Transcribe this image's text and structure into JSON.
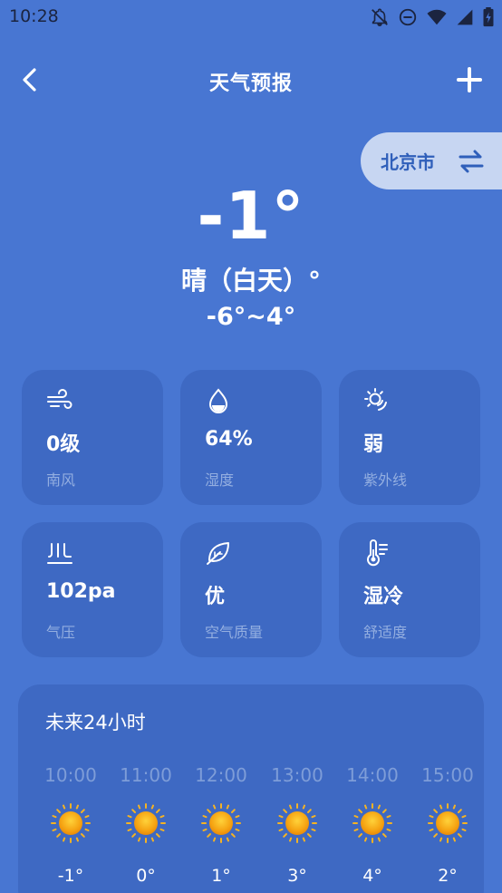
{
  "status_bar": {
    "time": "10:28",
    "icons": [
      "notifications-off-icon",
      "do-not-disturb-icon",
      "wifi-icon",
      "signal-icon",
      "battery-icon"
    ]
  },
  "app_bar": {
    "title": "天气预报",
    "back_icon": "chevron-left-icon",
    "add_icon": "plus-icon"
  },
  "location": {
    "city": "北京市",
    "switch_icon": "swap-arrows-icon"
  },
  "current": {
    "temperature": "-1°",
    "condition": "晴（白天）°",
    "range": "-6°~4°"
  },
  "tiles": [
    {
      "icon": "wind-icon",
      "value": "0级",
      "label": "南风"
    },
    {
      "icon": "humidity-icon",
      "value": "64%",
      "label": "湿度"
    },
    {
      "icon": "uv-sun-icon",
      "value": "弱",
      "label": "紫外线"
    },
    {
      "icon": "pressure-icon",
      "value": "102pa",
      "label": "气压"
    },
    {
      "icon": "leaf-icon",
      "value": "优",
      "label": "空气质量"
    },
    {
      "icon": "thermometer-icon",
      "value": "湿冷",
      "label": "舒适度"
    }
  ],
  "forecast": {
    "title": "未来24小时",
    "hours": [
      {
        "time": "10:00",
        "icon": "sunny-icon",
        "temp": "-1°"
      },
      {
        "time": "11:00",
        "icon": "sunny-icon",
        "temp": "0°"
      },
      {
        "time": "12:00",
        "icon": "sunny-icon",
        "temp": "1°"
      },
      {
        "time": "13:00",
        "icon": "sunny-icon",
        "temp": "3°"
      },
      {
        "time": "14:00",
        "icon": "sunny-icon",
        "temp": "4°"
      },
      {
        "time": "15:00",
        "icon": "sunny-icon",
        "temp": "2°"
      }
    ]
  },
  "colors": {
    "background": "#4876d2",
    "tile": "#3e69c3",
    "chip": "#c7d6f2",
    "chip_text": "#2f5fba",
    "muted_label": "#93aee0",
    "status_text": "#1b2440"
  }
}
